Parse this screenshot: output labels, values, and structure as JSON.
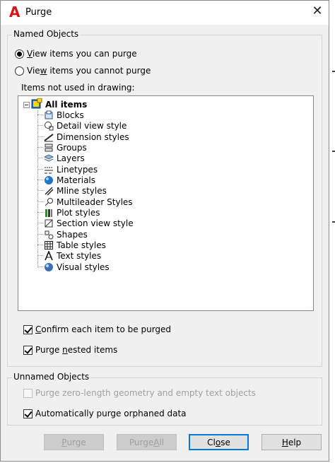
{
  "window": {
    "title": "Purge",
    "logo_letter": "A",
    "close_glyph": "✕"
  },
  "named_objects": {
    "legend": "Named Objects",
    "radio_purgeable": {
      "pre": "",
      "u": "V",
      "post": "iew items you can purge",
      "selected": true
    },
    "radio_not_purgeable": {
      "pre": "Vie",
      "u": "w",
      "post": " items you cannot purge",
      "selected": false
    },
    "tree_label": "Items not used in drawing:",
    "tree": {
      "root_label": "All items",
      "items": [
        {
          "label": "Blocks",
          "icon": "blocks-icon"
        },
        {
          "label": "Detail view style",
          "icon": "detail-view-style-icon"
        },
        {
          "label": "Dimension styles",
          "icon": "dimension-styles-icon"
        },
        {
          "label": "Groups",
          "icon": "groups-icon"
        },
        {
          "label": "Layers",
          "icon": "layers-icon"
        },
        {
          "label": "Linetypes",
          "icon": "linetypes-icon"
        },
        {
          "label": "Materials",
          "icon": "materials-icon"
        },
        {
          "label": "Mline styles",
          "icon": "mline-styles-icon"
        },
        {
          "label": "Multileader Styles",
          "icon": "multileader-styles-icon"
        },
        {
          "label": "Plot styles",
          "icon": "plot-styles-icon"
        },
        {
          "label": "Section view style",
          "icon": "section-view-style-icon"
        },
        {
          "label": "Shapes",
          "icon": "shapes-icon"
        },
        {
          "label": "Table styles",
          "icon": "table-styles-icon"
        },
        {
          "label": "Text styles",
          "icon": "text-styles-icon"
        },
        {
          "label": "Visual styles",
          "icon": "visual-styles-icon"
        }
      ]
    },
    "confirm": {
      "pre": "",
      "u": "C",
      "post": "onfirm each item to be purged",
      "checked": true
    },
    "nested": {
      "pre": "Purge ",
      "u": "n",
      "post": "ested items",
      "checked": true
    }
  },
  "unnamed_objects": {
    "legend": "Unnamed Objects",
    "zero_length": {
      "label": "Purge zero-length geometry and empty text objects",
      "checked": false,
      "enabled": false
    },
    "orphaned": {
      "label": "Automatically purge orphaned data",
      "checked": true
    }
  },
  "buttons": {
    "purge": {
      "pre": "",
      "u": "P",
      "post": "urge",
      "enabled": false
    },
    "purge_all": {
      "pre": "Purge ",
      "u": "A",
      "post": "ll",
      "enabled": false
    },
    "close": {
      "pre": "Cl",
      "u": "o",
      "post": "se",
      "enabled": true
    },
    "help": {
      "pre": "",
      "u": "H",
      "post": "elp",
      "enabled": true
    }
  }
}
